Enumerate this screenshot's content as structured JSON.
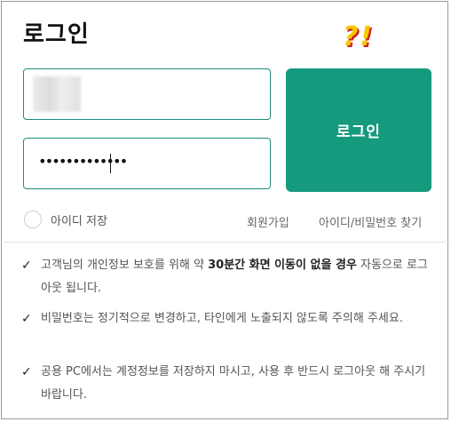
{
  "header": {
    "title": "로그인",
    "annotation": "?!"
  },
  "form": {
    "id_value": "",
    "password_mask": "•••••••••••••",
    "login_label": "로그인",
    "save_id_label": "아이디 저장",
    "signup_link": "회원가입",
    "find_link": "아이디/비밀번호 찾기"
  },
  "notices": [
    {
      "before": "고객님의 개인정보 보호를 위해 약 ",
      "strong": "30분간 화면 이동이 없을 경우",
      "after": " 자동으로 로그아웃 됩니다."
    },
    {
      "text": "비밀번호는 정기적으로 변경하고, 타인에게 노출되지 않도록 주의해 주세요."
    },
    {
      "text": "공용 PC에서는 계정정보를 저장하지 마시고, 사용 후 반드시 로그아웃 해 주시기 바랍니다."
    }
  ],
  "check_symbol": "✓",
  "colors": {
    "accent": "#159a7e",
    "input_border": "#1b8f7d",
    "annotation_fill": "#f7c800",
    "annotation_shadow": "#d02020"
  }
}
